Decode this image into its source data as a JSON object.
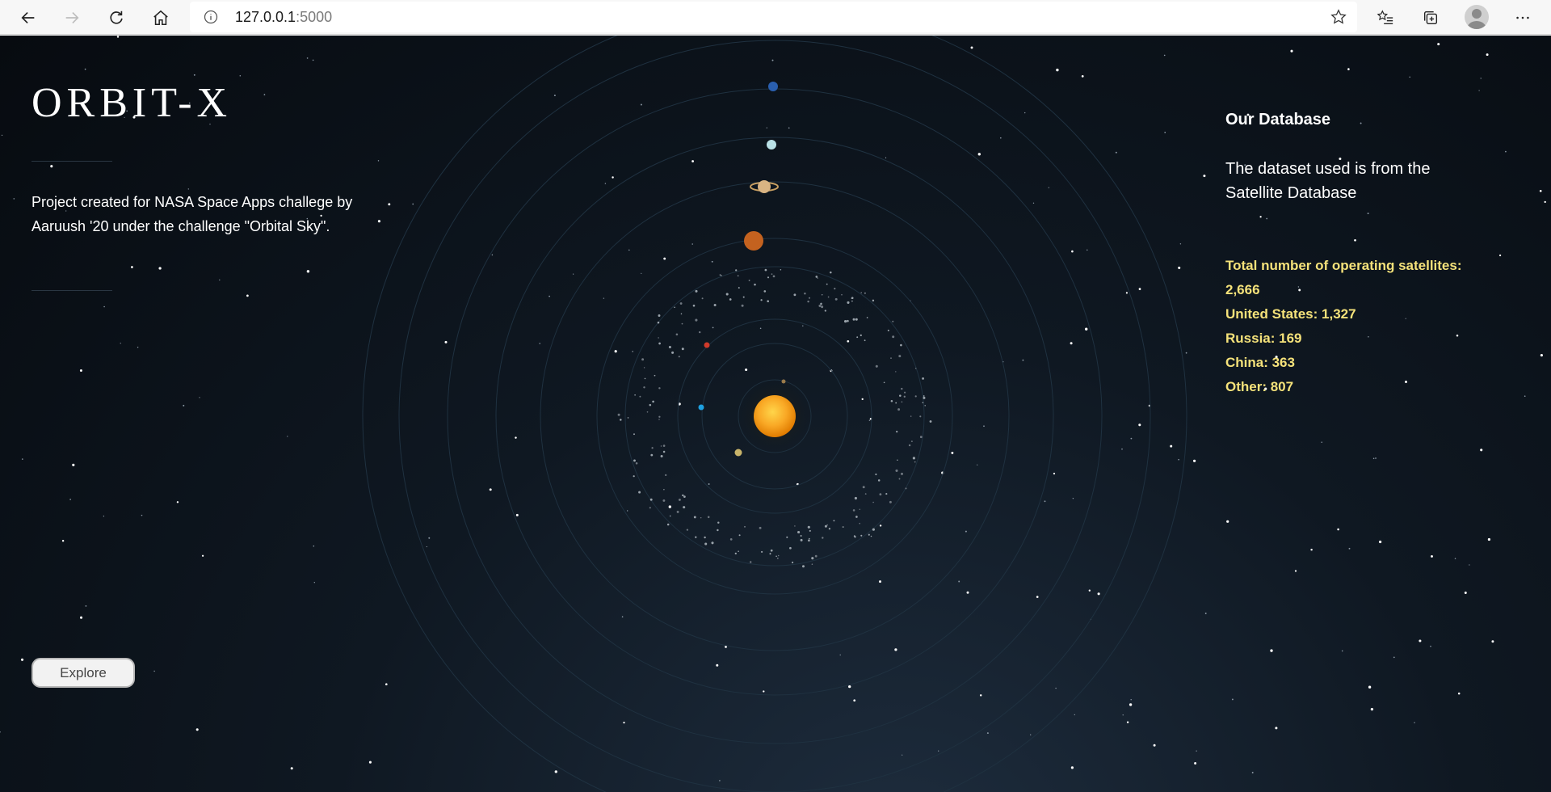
{
  "browser": {
    "url_host": "127.0.0.1",
    "url_port": ":5000"
  },
  "page": {
    "title": "ORBIT-X",
    "description": "Project created for NASA Space Apps challege by Aaruush '20 under the challenge \"Orbital Sky\".",
    "explore_label": "Explore",
    "database": {
      "heading": "Our Database",
      "text": "The dataset used is from the Satellite Database",
      "stats": [
        "Total number of operating satellites: 2,666",
        "United States: 1,327",
        "Russia: 169",
        "China: 363",
        "Other: 807"
      ]
    }
  },
  "colors": {
    "stats_text": "#f5e27a",
    "sun": "#f9a825",
    "background": "#0b1219"
  }
}
